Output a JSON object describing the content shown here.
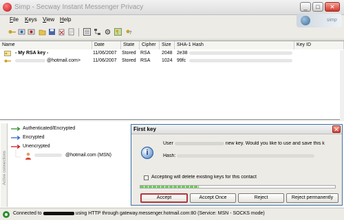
{
  "window": {
    "title": "Simp - Secway Instant Messenger Privacy"
  },
  "menu": [
    "File",
    "Keys",
    "View",
    "Help"
  ],
  "toolbar": {
    "icons": [
      "new-key-icon",
      "import-icon",
      "export-icon",
      "open-icon",
      "save-icon",
      "delete-icon",
      "properties-icon",
      "view-list-icon",
      "network-icon",
      "settings-icon",
      "active-key-icon",
      "help-icon"
    ]
  },
  "keylist": {
    "columns": [
      "Name",
      "Date",
      "State",
      "Cipher",
      "Size",
      "SHA-1 Hash",
      "Key ID"
    ],
    "rows": [
      {
        "name": "- My RSA key -",
        "date": "11/06/2007",
        "state": "Stored",
        "cipher": "RSA",
        "size": "2048",
        "hash": "2e38",
        "key_id": ""
      },
      {
        "name": "@hotmail.com>",
        "date": "11/06/2007",
        "state": "Stored",
        "cipher": "RSA",
        "size": "1024",
        "hash": "99fc",
        "key_id": ""
      }
    ]
  },
  "connections": {
    "sidebar_label": "Active connections",
    "legend": [
      "Authenticated/Encrypted",
      "Encrypted",
      "Unencrypted"
    ],
    "contact": "@hotmail.com (MSN)"
  },
  "dialog": {
    "title": "First key",
    "message_prefix": "User",
    "message_suffix": "new key. Would you like to use and save this k",
    "hash_label": "Hash:",
    "checkbox_label": "Accepting will delete existing keys for this contact",
    "progress": 0.3,
    "buttons": {
      "accept": "Accept",
      "accept_once": "Accept Once",
      "reject": "Reject",
      "reject_permanently": "Reject permanently"
    }
  },
  "status": {
    "prefix": "Connected to",
    "text": "using HTTP through gateway.messenger.hotmail.com:80 (Service: MSN - SOCKS mode)"
  },
  "colors": {
    "accent": "#3a6ea5",
    "green": "#2e8b2e",
    "blue": "#2b5fcc",
    "red": "#c0151a"
  }
}
